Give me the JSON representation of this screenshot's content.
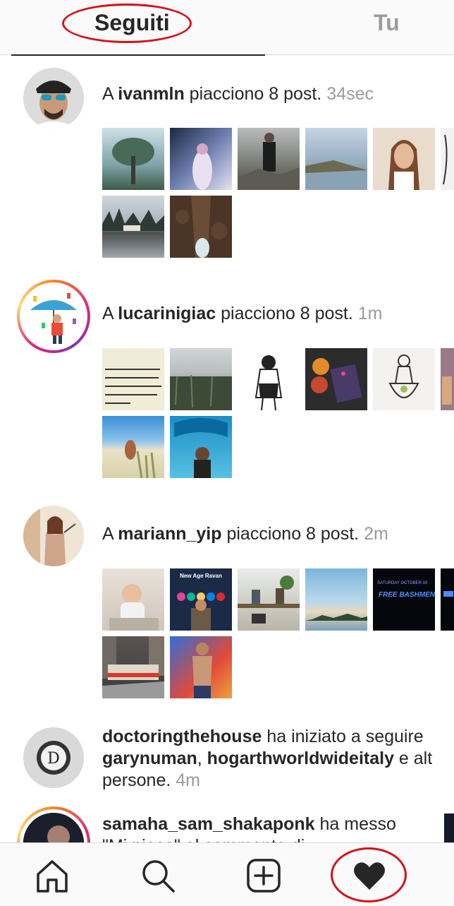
{
  "tabs": {
    "following": "Seguiti",
    "you": "Tu"
  },
  "activity": [
    {
      "prefix": "A ",
      "user": "ivanmln",
      "suffix": " piacciono 8 post.",
      "time": "34sec"
    },
    {
      "prefix": "A ",
      "user": "lucarinigiac",
      "suffix": " piacciono 8 post.",
      "time": "1m"
    },
    {
      "prefix": "A ",
      "user": "mariann_yip",
      "suffix": " piacciono 8 post.",
      "time": "2m"
    },
    {
      "user": "doctoringthehouse",
      "action": " ha iniziato a seguire",
      "target1": "garynuman",
      "sep": ", ",
      "target2": "hogarthworldwideitaly",
      "more": " e alt",
      "line3": "persone.",
      "time": "4m"
    },
    {
      "user": "samaha_sam_shakaponk",
      "action": " ha messo",
      "line2": "\"Mi piace\" al commento di"
    }
  ],
  "thumb_text": {
    "poster_title": "New Age Ravan",
    "event_date": "SATURDAY OCTOBER 19",
    "event_name": "FREE BASHMENT"
  },
  "colors": {
    "annotation": "#d3131a",
    "time": "#9b9b9b",
    "text": "#262626"
  },
  "icons": [
    "home-icon",
    "search-icon",
    "new-post-icon",
    "heart-icon"
  ]
}
